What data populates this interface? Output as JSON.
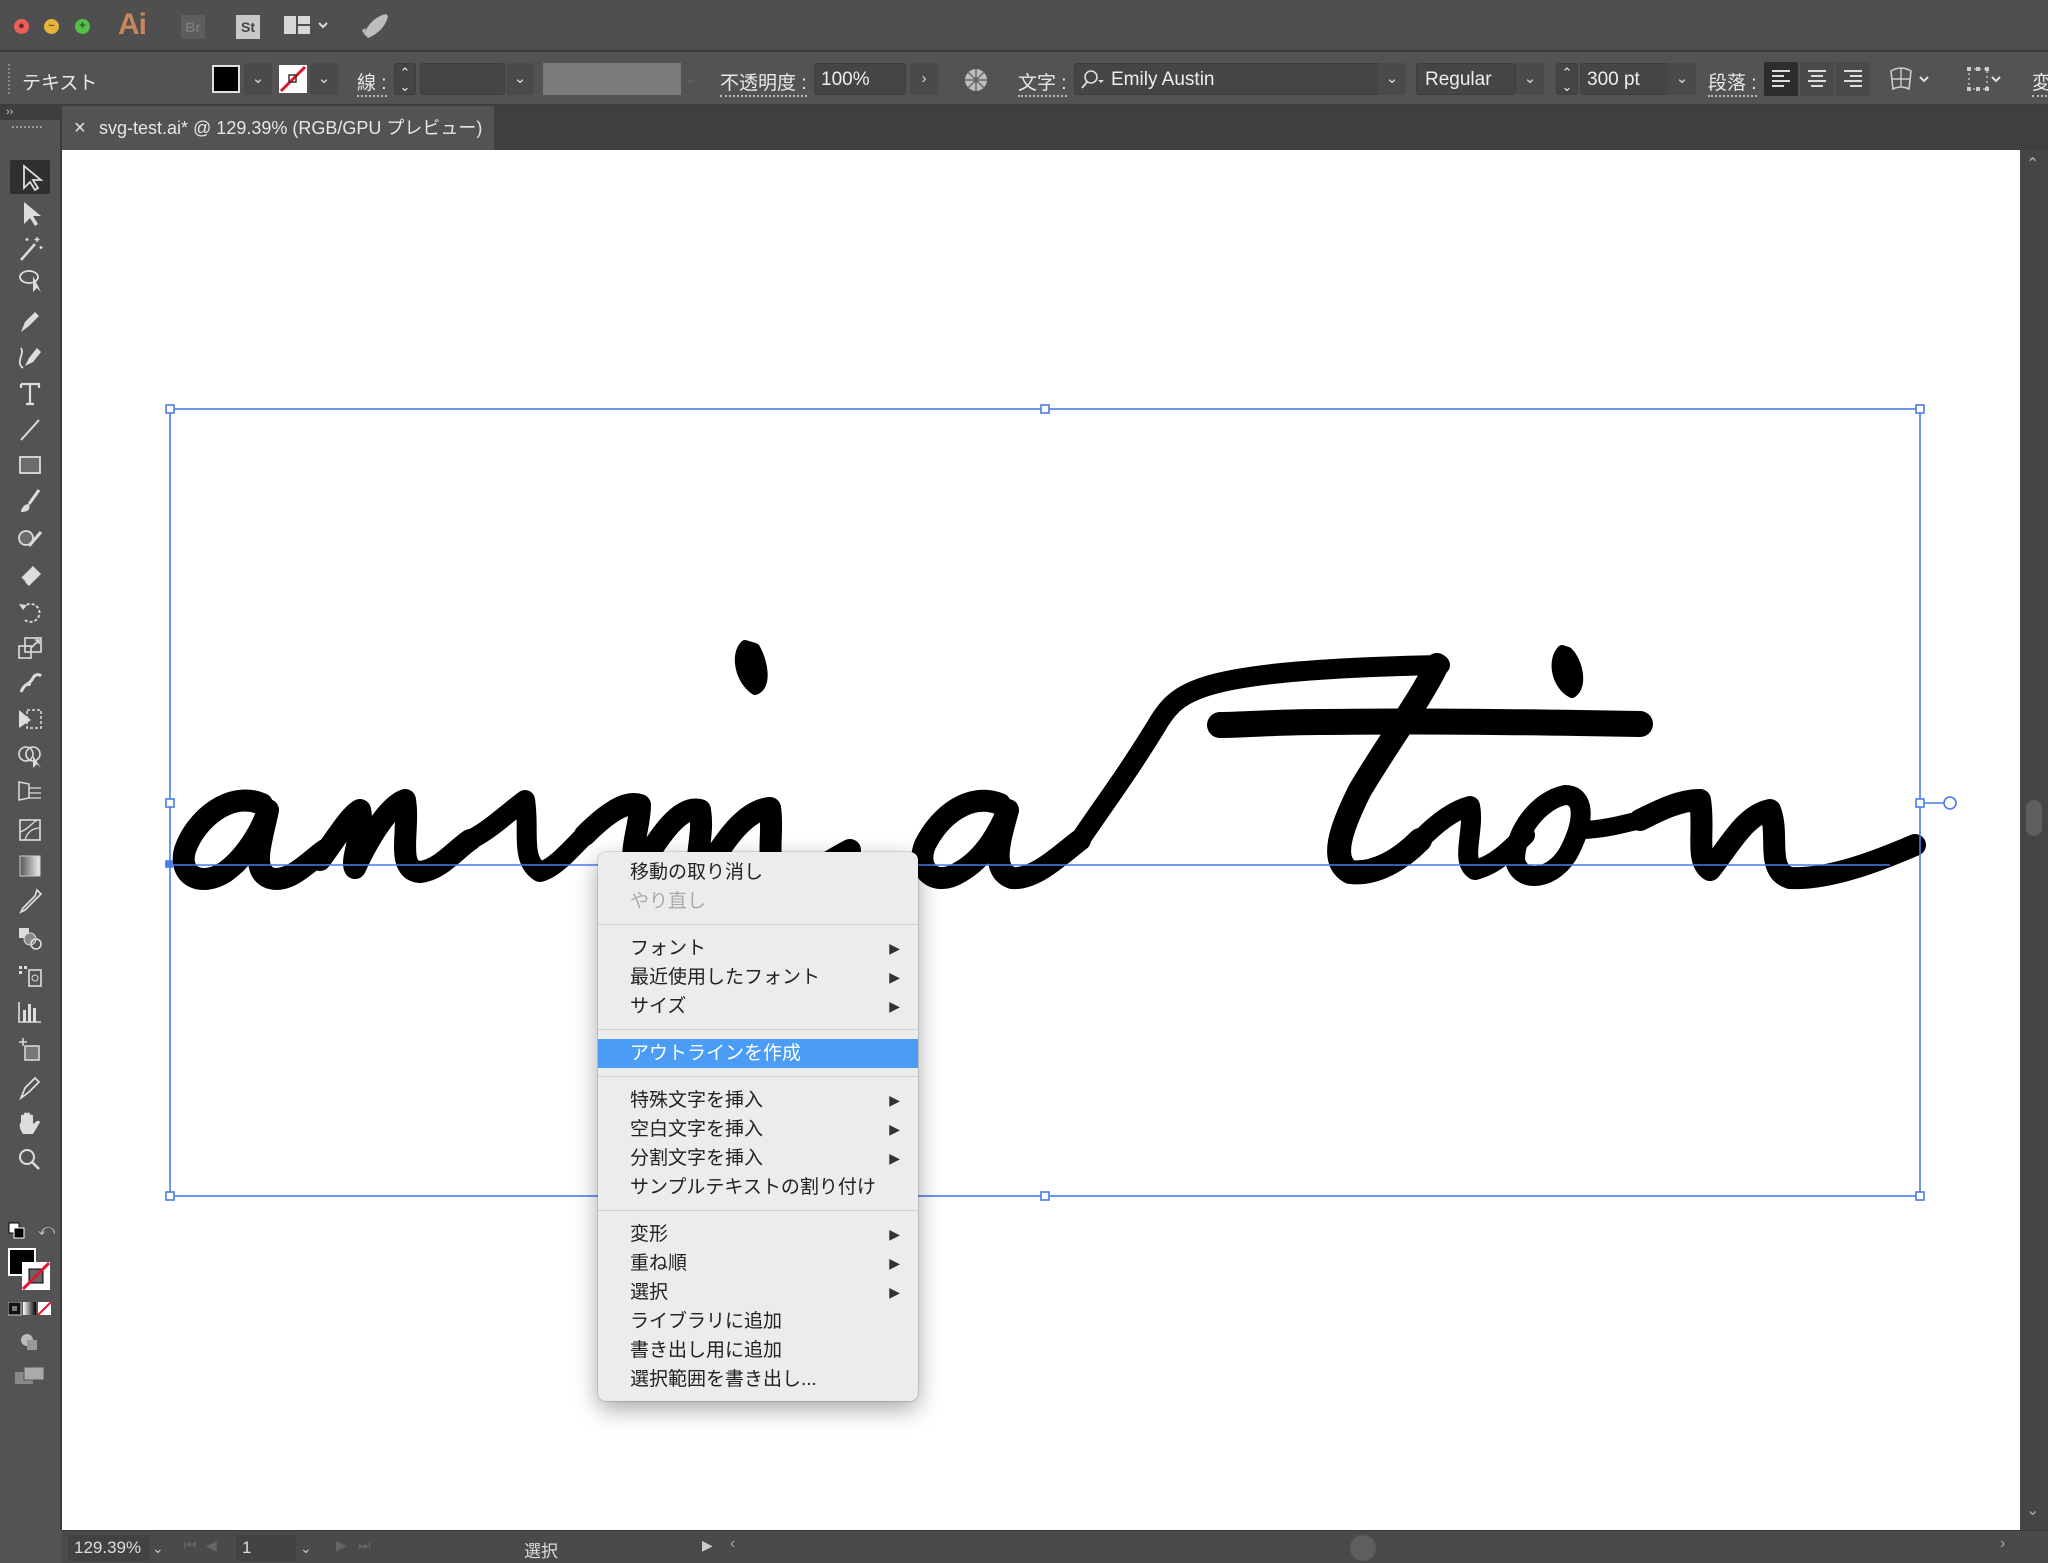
{
  "app": {
    "logo": "Ai",
    "bridge_label": "Br",
    "stock_label": "St"
  },
  "control_bar": {
    "selection_type": "テキスト",
    "stroke_label": "線 :",
    "opacity_label": "不透明度 :",
    "opacity_value": "100%",
    "character_label": "文字 :",
    "font_family": "Emily Austin",
    "font_style": "Regular",
    "font_size": "300 pt",
    "paragraph_label": "段落 :",
    "transform_label_partial": "変",
    "fill_color": "#000000",
    "stroke_color": "none"
  },
  "document_tab": {
    "close_glyph": "×",
    "title": "svg-test.ai* @ 129.39% (RGB/GPU プレビュー)"
  },
  "canvas": {
    "text_object": "animation",
    "selection_color": "#4a7ce8"
  },
  "context_menu": {
    "groups": [
      [
        {
          "label": "移動の取り消し",
          "enabled": true,
          "submenu": false
        },
        {
          "label": "やり直し",
          "enabled": false,
          "submenu": false
        }
      ],
      [
        {
          "label": "フォント",
          "enabled": true,
          "submenu": true
        },
        {
          "label": "最近使用したフォント",
          "enabled": true,
          "submenu": true
        },
        {
          "label": "サイズ",
          "enabled": true,
          "submenu": true
        }
      ],
      [
        {
          "label": "アウトラインを作成",
          "enabled": true,
          "submenu": false,
          "highlighted": true
        }
      ],
      [
        {
          "label": "特殊文字を挿入",
          "enabled": true,
          "submenu": true
        },
        {
          "label": "空白文字を挿入",
          "enabled": true,
          "submenu": true
        },
        {
          "label": "分割文字を挿入",
          "enabled": true,
          "submenu": true
        },
        {
          "label": "サンプルテキストの割り付け",
          "enabled": true,
          "submenu": false
        }
      ],
      [
        {
          "label": "変形",
          "enabled": true,
          "submenu": true
        },
        {
          "label": "重ね順",
          "enabled": true,
          "submenu": true
        },
        {
          "label": "選択",
          "enabled": true,
          "submenu": true
        },
        {
          "label": "ライブラリに追加",
          "enabled": true,
          "submenu": false
        },
        {
          "label": "書き出し用に追加",
          "enabled": true,
          "submenu": false
        },
        {
          "label": "選択範囲を書き出し...",
          "enabled": true,
          "submenu": false
        }
      ]
    ],
    "highlight_color": "#4a9cf5",
    "submenu_arrow": "▶"
  },
  "status_bar": {
    "zoom": "129.39%",
    "artboard_number": "1",
    "current_tool": "選択"
  },
  "toolbar": {
    "tools": [
      "selection-tool",
      "direct-selection-tool",
      "magic-wand-tool",
      "lasso-tool",
      "pen-tool",
      "curvature-tool",
      "type-tool",
      "line-segment-tool",
      "rectangle-tool",
      "paintbrush-tool",
      "shaper-tool",
      "eraser-tool",
      "rotate-tool",
      "scale-tool",
      "width-tool",
      "free-transform-tool",
      "shape-builder-tool",
      "perspective-grid-tool",
      "mesh-tool",
      "gradient-tool",
      "eyedropper-tool",
      "blend-tool",
      "symbol-sprayer-tool",
      "column-graph-tool",
      "artboard-tool",
      "slice-tool",
      "hand-tool",
      "zoom-tool"
    ]
  }
}
